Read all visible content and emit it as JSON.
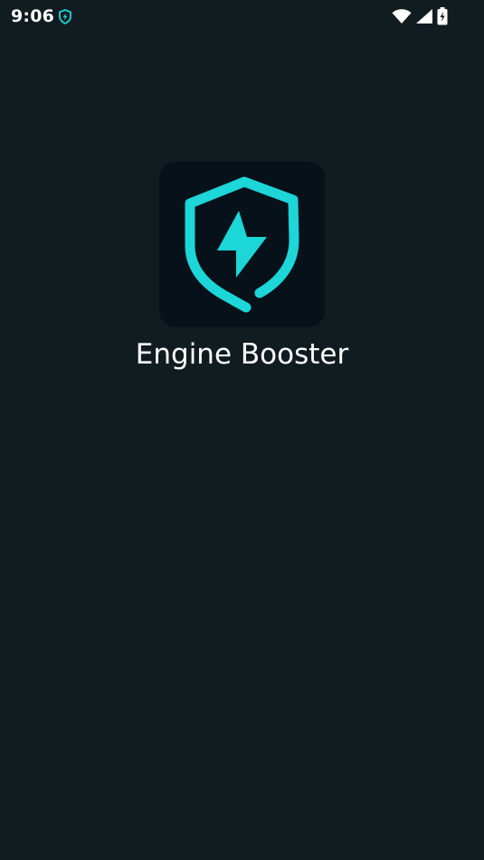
{
  "status_bar": {
    "time": "9:06",
    "notification_icon": "shield-bolt-icon",
    "icons": [
      "wifi-icon",
      "cellular-signal-icon",
      "battery-charging-icon"
    ]
  },
  "splash": {
    "app_icon": "shield-bolt-icon",
    "app_name": "Engine Booster"
  },
  "colors": {
    "background": "#111c21",
    "icon_tile": "#07111a",
    "accent": "#1cd6d8",
    "text": "#ffffff"
  }
}
